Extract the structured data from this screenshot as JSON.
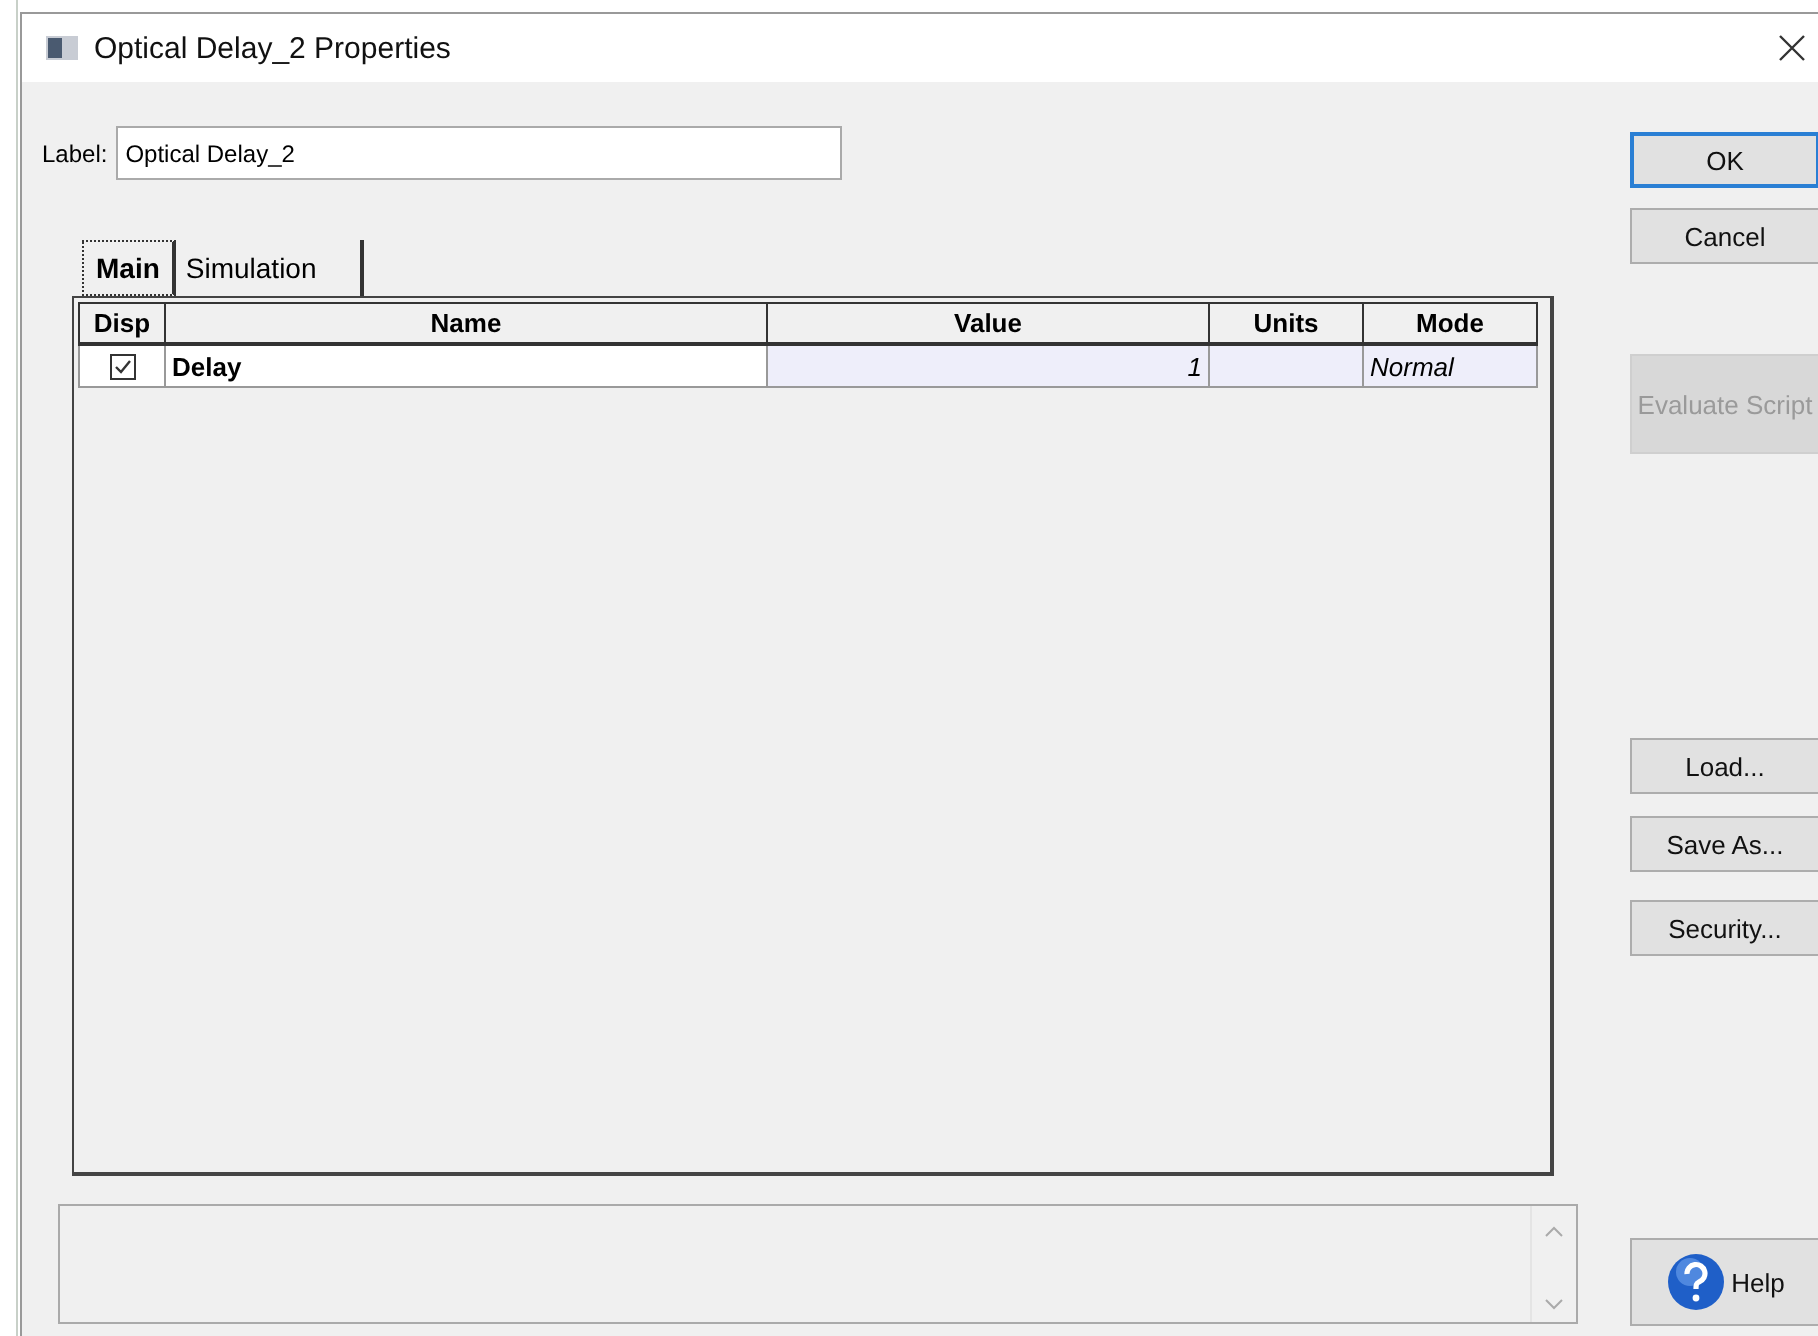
{
  "window": {
    "title": "Optical Delay_2 Properties"
  },
  "label_field": {
    "label": "Label:",
    "value": "Optical Delay_2"
  },
  "tabs": [
    {
      "label": "Main",
      "selected": true
    },
    {
      "label": "Simulation",
      "selected": false
    }
  ],
  "table": {
    "columns": [
      "Disp",
      "Name",
      "Value",
      "Units",
      "Mode"
    ],
    "rows": [
      {
        "disp": true,
        "name": "Delay",
        "value": "1",
        "mode": "Normal"
      }
    ]
  },
  "buttons": [
    {
      "label": "OK",
      "kind": "default",
      "disabled": false
    },
    {
      "label": "Cancel",
      "kind": "normal",
      "disabled": false
    },
    {
      "label": "Evaluate Script",
      "kind": "normal",
      "disabled": true
    },
    {
      "label": "Load...",
      "kind": "normal",
      "disabled": false
    },
    {
      "label": "Save As...",
      "kind": "normal",
      "disabled": false
    },
    {
      "label": "Security...",
      "kind": "normal",
      "disabled": false
    },
    {
      "label": "Help",
      "kind": "help",
      "disabled": false
    }
  ]
}
